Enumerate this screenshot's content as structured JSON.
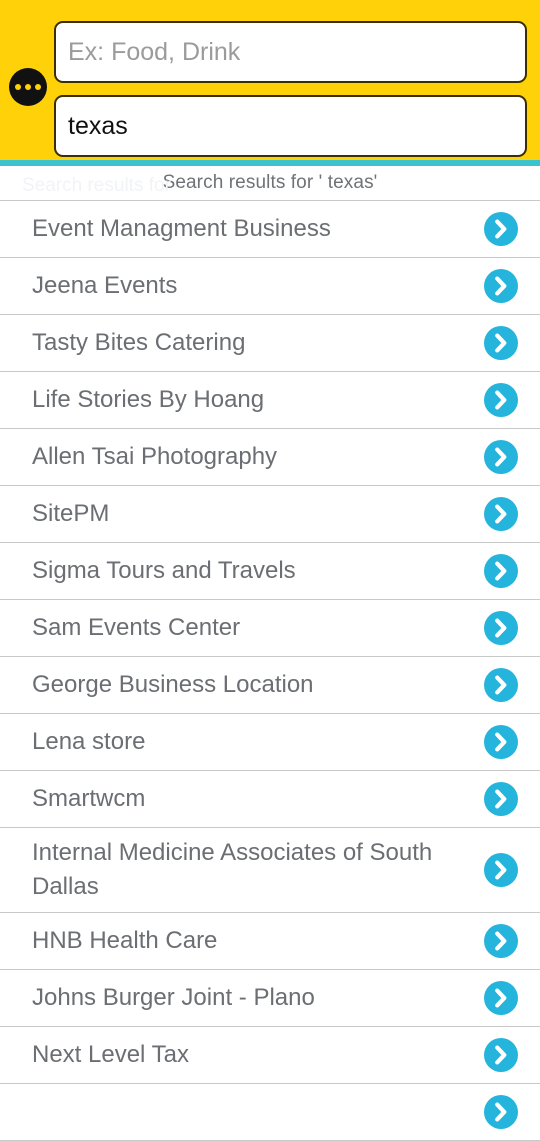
{
  "header": {
    "background_color": "#FFD108",
    "overflow_menu": {
      "icon": "overflow-menu-icon",
      "label": "More options"
    },
    "category_input": {
      "value": "",
      "placeholder": "Ex: Food, Drink"
    },
    "search_input": {
      "value": "texas",
      "placeholder": ""
    },
    "divider_color": "#3BC3CE"
  },
  "results": {
    "caption": "Search results for ' texas'",
    "ghost_caption": "Search results for",
    "chevron_icon": "chevron-right-icon",
    "chevron_color": "#24B4DC",
    "items": [
      {
        "name": "Event Managment Business"
      },
      {
        "name": "Jeena Events"
      },
      {
        "name": "Tasty Bites Catering"
      },
      {
        "name": "Life Stories By Hoang"
      },
      {
        "name": "Allen Tsai Photography"
      },
      {
        "name": "SitePM"
      },
      {
        "name": "Sigma Tours and Travels"
      },
      {
        "name": "Sam Events Center"
      },
      {
        "name": "George Business Location"
      },
      {
        "name": "Lena store"
      },
      {
        "name": "Smartwcm"
      },
      {
        "name": "Internal Medicine Associates of South Dallas"
      },
      {
        "name": "HNB Health Care"
      },
      {
        "name": "Johns Burger Joint - Plano"
      },
      {
        "name": "Next Level Tax"
      },
      {
        "name": ""
      }
    ]
  }
}
